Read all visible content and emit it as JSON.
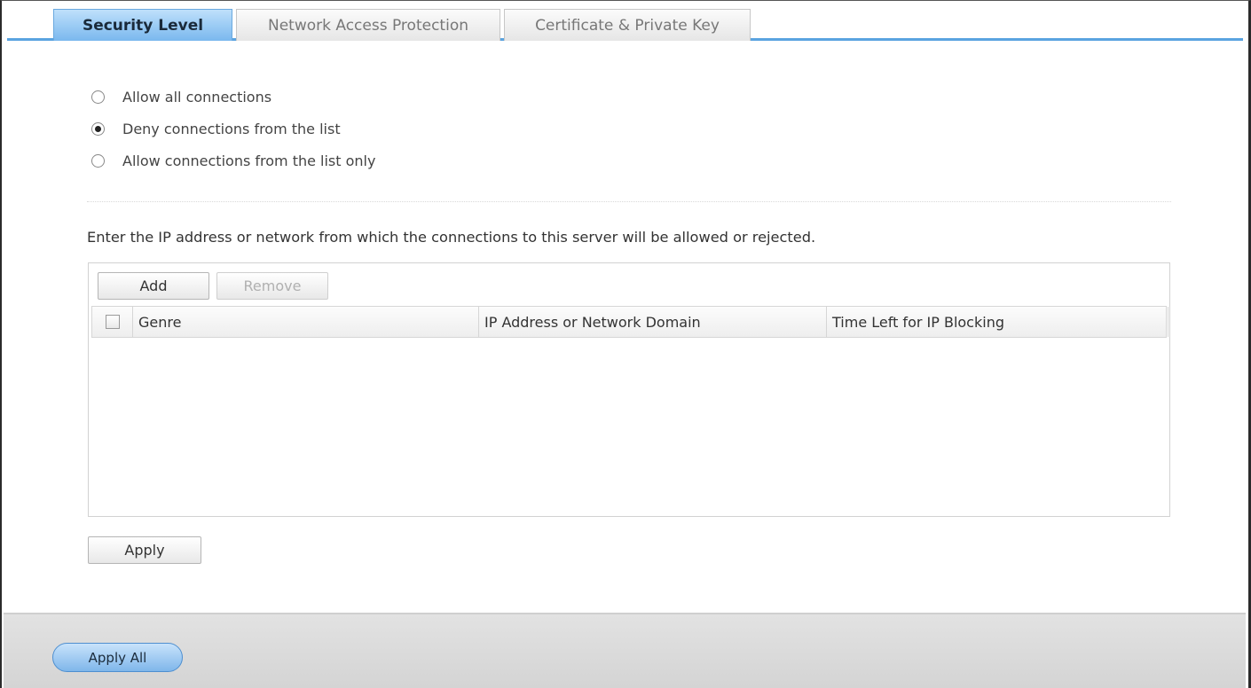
{
  "tabs": [
    {
      "label": "Security Level",
      "active": true
    },
    {
      "label": "Network Access Protection",
      "active": false
    },
    {
      "label": "Certificate & Private Key",
      "active": false
    }
  ],
  "security_options": [
    {
      "label": "Allow all connections",
      "checked": false
    },
    {
      "label": "Deny connections from the list",
      "checked": true
    },
    {
      "label": "Allow connections from the list only",
      "checked": false
    }
  ],
  "description": "Enter the IP address or network from which the connections to this server will be allowed or rejected.",
  "list_toolbar": {
    "add_label": "Add",
    "remove_label": "Remove",
    "remove_enabled": false
  },
  "table": {
    "columns": [
      "Genre",
      "IP Address or Network Domain",
      "Time Left for IP Blocking"
    ],
    "rows": []
  },
  "apply_label": "Apply",
  "footer": {
    "apply_all_label": "Apply All"
  },
  "colors": {
    "accent": "#5aa3e0",
    "active_tab": "#7ab8ee",
    "footer": "#d4d4d4"
  }
}
